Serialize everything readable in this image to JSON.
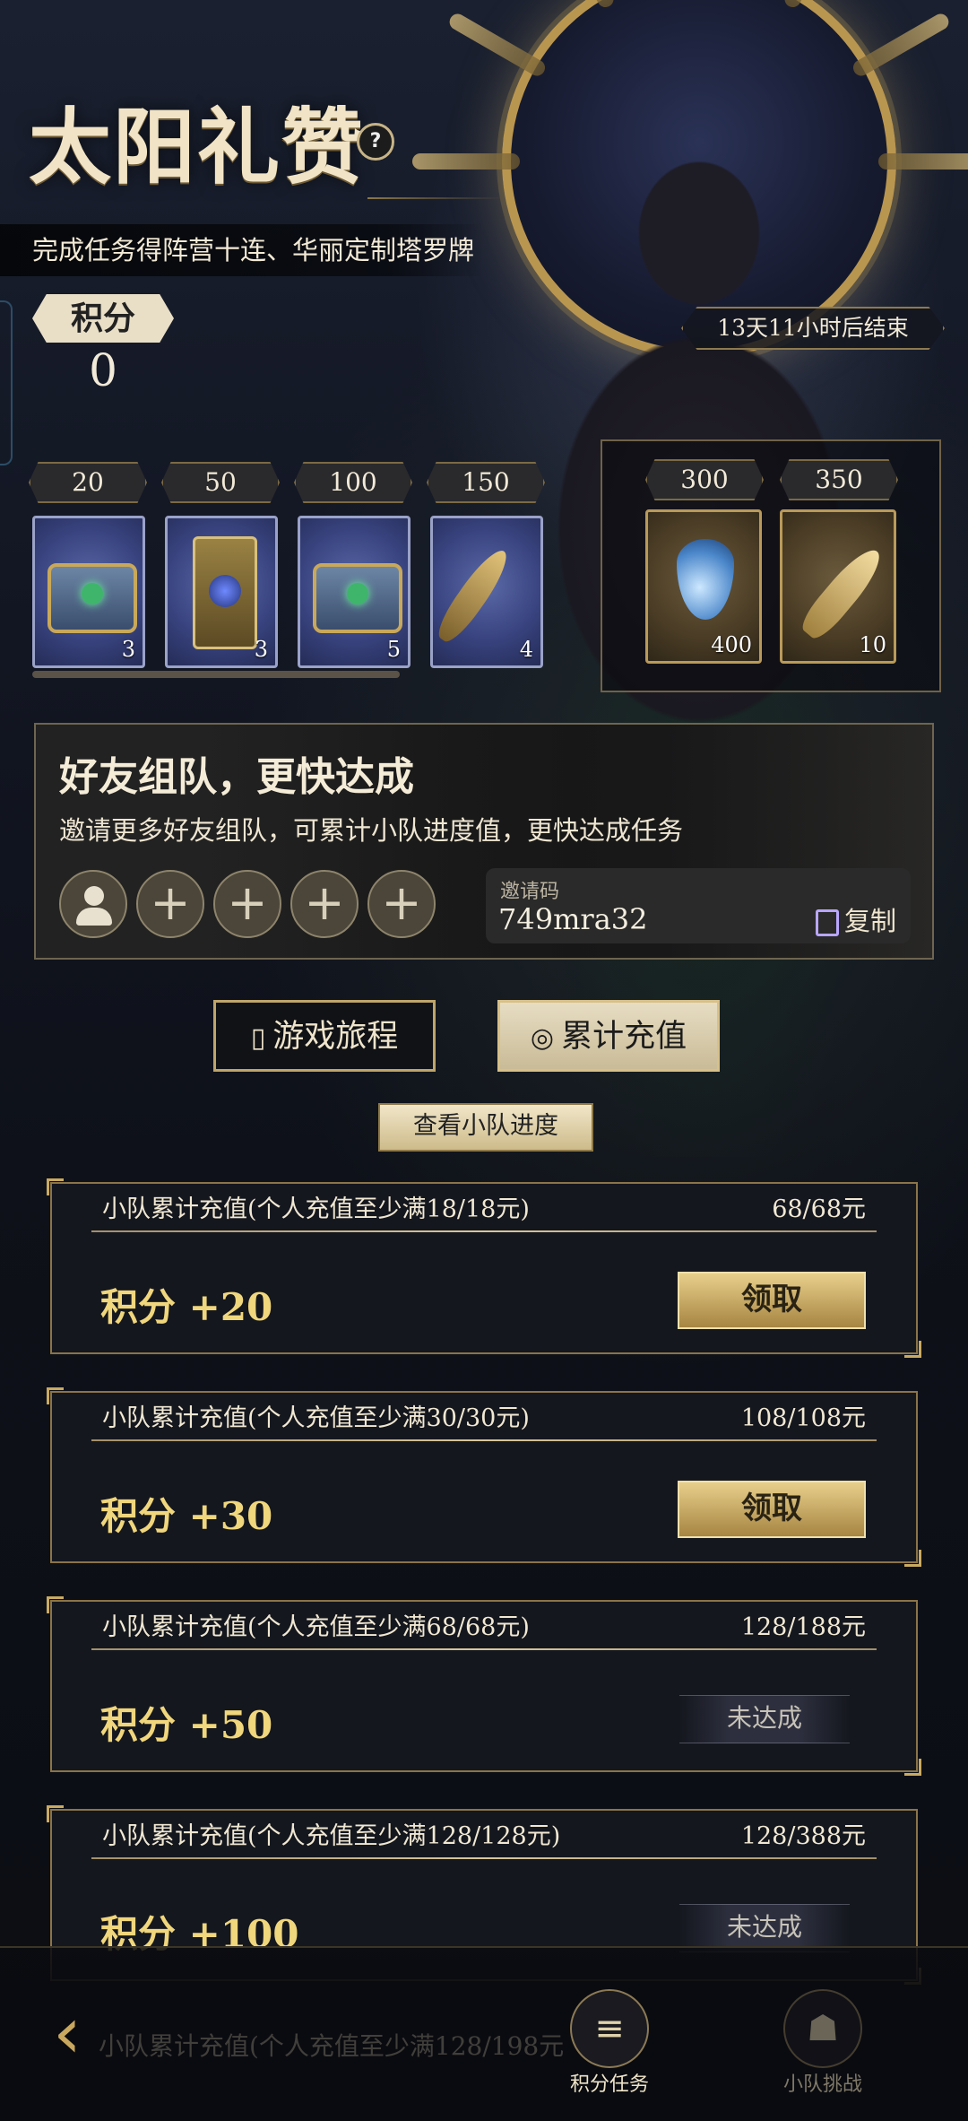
{
  "hero": {
    "title": "太阳礼赞",
    "help_glyph": "?",
    "subtitle": "完成任务得阵营十连、华丽定制塔罗牌",
    "points_label": "积分",
    "points_value": "0",
    "timer": "13天11小时后结束"
  },
  "rewards": [
    {
      "threshold": "20",
      "icon": "treasure-chest-icon",
      "count": "3"
    },
    {
      "threshold": "50",
      "icon": "tarot-card-icon",
      "count": "3"
    },
    {
      "threshold": "100",
      "icon": "treasure-chest-icon",
      "count": "5"
    },
    {
      "threshold": "150",
      "icon": "dark-feather-icon",
      "count": "4"
    }
  ],
  "big_rewards": [
    {
      "threshold": "300",
      "icon": "blue-crystal-icon",
      "count": "400"
    },
    {
      "threshold": "350",
      "icon": "golden-feather-icon",
      "count": "10"
    }
  ],
  "team": {
    "title": "好友组队，更快达成",
    "description": "邀请更多好友组队，可累计小队进度值，更快达成任务",
    "add_glyph": "+",
    "invite_label": "邀请码",
    "invite_code": "749mra32",
    "copy_label": "复制"
  },
  "tabs": {
    "journey": "游戏旅程",
    "recharge": "累计充值",
    "journey_icon": "map-icon",
    "recharge_icon": "coin-icon"
  },
  "view_progress": "查看小队进度",
  "tasks": [
    {
      "title": "小队累计充值(个人充值至少满18/18元)",
      "progress": "68/68元",
      "points": "积分 +20",
      "action": "领取"
    },
    {
      "title": "小队累计充值(个人充值至少满30/30元)",
      "progress": "108/108元",
      "points": "积分 +30",
      "action": "领取"
    },
    {
      "title": "小队累计充值(个人充值至少满68/68元)",
      "progress": "128/188元",
      "points": "积分 +50",
      "action": "未达成"
    },
    {
      "title": "小队累计充值(个人充值至少满128/128元)",
      "progress": "128/388元",
      "points": "积分 +100",
      "action": "未达成"
    }
  ],
  "nav": {
    "back_glyph": "‹",
    "ghost_text": "小队累计充值(个人充值至少满128/198元",
    "points_task": "积分任务",
    "team_challenge": "小队挑战"
  },
  "colors": {
    "accent_gold": "#c9aa62",
    "claim_gold": "#e7cf8b",
    "points_yellow": "#f0d67c"
  }
}
